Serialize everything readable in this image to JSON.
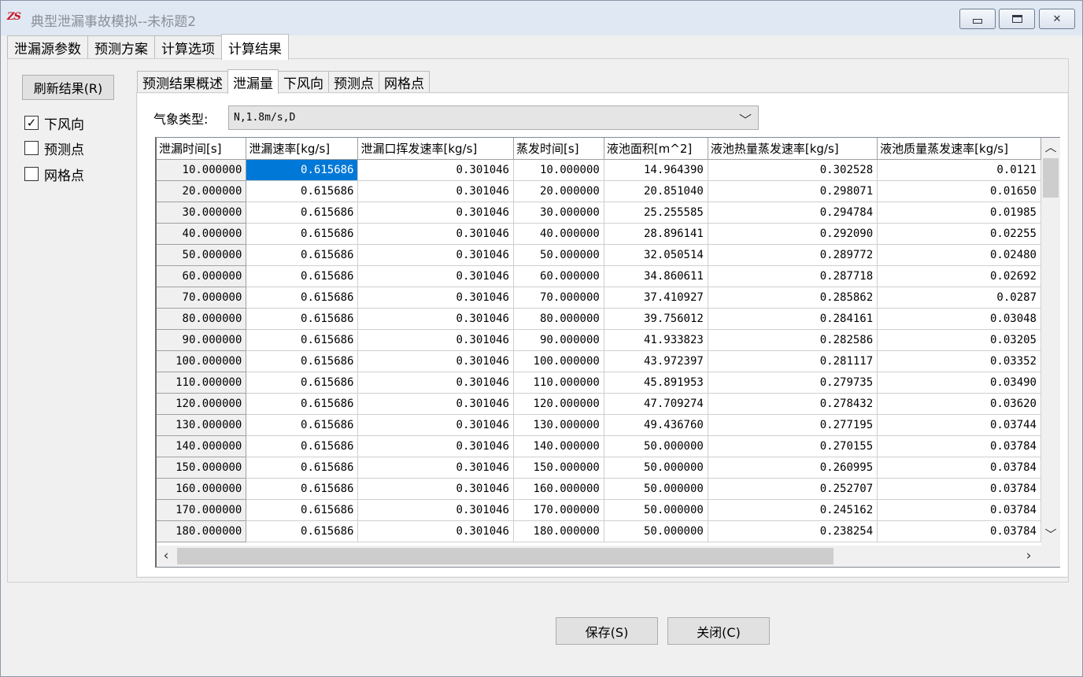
{
  "window": {
    "logo_text": "ZS",
    "title": "典型泄漏事故模拟--未标题2"
  },
  "main_tabs": [
    {
      "label": "泄漏源参数",
      "active": false
    },
    {
      "label": "预测方案",
      "active": false
    },
    {
      "label": "计算选项",
      "active": false
    },
    {
      "label": "计算结果",
      "active": true
    }
  ],
  "left_panel": {
    "refresh_label": "刷新结果(R)",
    "checkboxes": [
      {
        "label": "下风向",
        "checked": true
      },
      {
        "label": "预测点",
        "checked": false
      },
      {
        "label": "网格点",
        "checked": false
      }
    ]
  },
  "sub_tabs": [
    {
      "label": "预测结果概述",
      "active": false
    },
    {
      "label": "泄漏量",
      "active": true
    },
    {
      "label": "下风向",
      "active": false
    },
    {
      "label": "预测点",
      "active": false
    },
    {
      "label": "网格点",
      "active": false
    }
  ],
  "weather": {
    "label": "气象类型:",
    "value": "N,1.8m/s,D"
  },
  "grid": {
    "columns": [
      "泄漏时间[s]",
      "泄漏速率[kg/s]",
      "泄漏口挥发速率[kg/s]",
      "蒸发时间[s]",
      "液池面积[m^2]",
      "液池热量蒸发速率[kg/s]",
      "液池质量蒸发速率[kg/s]"
    ],
    "rows": [
      [
        "10.000000",
        "0.615686",
        "0.301046",
        "10.000000",
        "14.964390",
        "0.302528",
        "0.0121"
      ],
      [
        "20.000000",
        "0.615686",
        "0.301046",
        "20.000000",
        "20.851040",
        "0.298071",
        "0.01650"
      ],
      [
        "30.000000",
        "0.615686",
        "0.301046",
        "30.000000",
        "25.255585",
        "0.294784",
        "0.01985"
      ],
      [
        "40.000000",
        "0.615686",
        "0.301046",
        "40.000000",
        "28.896141",
        "0.292090",
        "0.02255"
      ],
      [
        "50.000000",
        "0.615686",
        "0.301046",
        "50.000000",
        "32.050514",
        "0.289772",
        "0.02480"
      ],
      [
        "60.000000",
        "0.615686",
        "0.301046",
        "60.000000",
        "34.860611",
        "0.287718",
        "0.02692"
      ],
      [
        "70.000000",
        "0.615686",
        "0.301046",
        "70.000000",
        "37.410927",
        "0.285862",
        "0.0287"
      ],
      [
        "80.000000",
        "0.615686",
        "0.301046",
        "80.000000",
        "39.756012",
        "0.284161",
        "0.03048"
      ],
      [
        "90.000000",
        "0.615686",
        "0.301046",
        "90.000000",
        "41.933823",
        "0.282586",
        "0.03205"
      ],
      [
        "100.000000",
        "0.615686",
        "0.301046",
        "100.000000",
        "43.972397",
        "0.281117",
        "0.03352"
      ],
      [
        "110.000000",
        "0.615686",
        "0.301046",
        "110.000000",
        "45.891953",
        "0.279735",
        "0.03490"
      ],
      [
        "120.000000",
        "0.615686",
        "0.301046",
        "120.000000",
        "47.709274",
        "0.278432",
        "0.03620"
      ],
      [
        "130.000000",
        "0.615686",
        "0.301046",
        "130.000000",
        "49.436760",
        "0.277195",
        "0.03744"
      ],
      [
        "140.000000",
        "0.615686",
        "0.301046",
        "140.000000",
        "50.000000",
        "0.270155",
        "0.03784"
      ],
      [
        "150.000000",
        "0.615686",
        "0.301046",
        "150.000000",
        "50.000000",
        "0.260995",
        "0.03784"
      ],
      [
        "160.000000",
        "0.615686",
        "0.301046",
        "160.000000",
        "50.000000",
        "0.252707",
        "0.03784"
      ],
      [
        "170.000000",
        "0.615686",
        "0.301046",
        "170.000000",
        "50.000000",
        "0.245162",
        "0.03784"
      ],
      [
        "180.000000",
        "0.615686",
        "0.301046",
        "180.000000",
        "50.000000",
        "0.238254",
        "0.03784"
      ]
    ]
  },
  "buttons": {
    "save": "保存(S)",
    "close": "关闭(C)"
  },
  "colors": {
    "selection": "#0078d7",
    "title_text": "#8a8f97",
    "logo": "#c8141e"
  }
}
